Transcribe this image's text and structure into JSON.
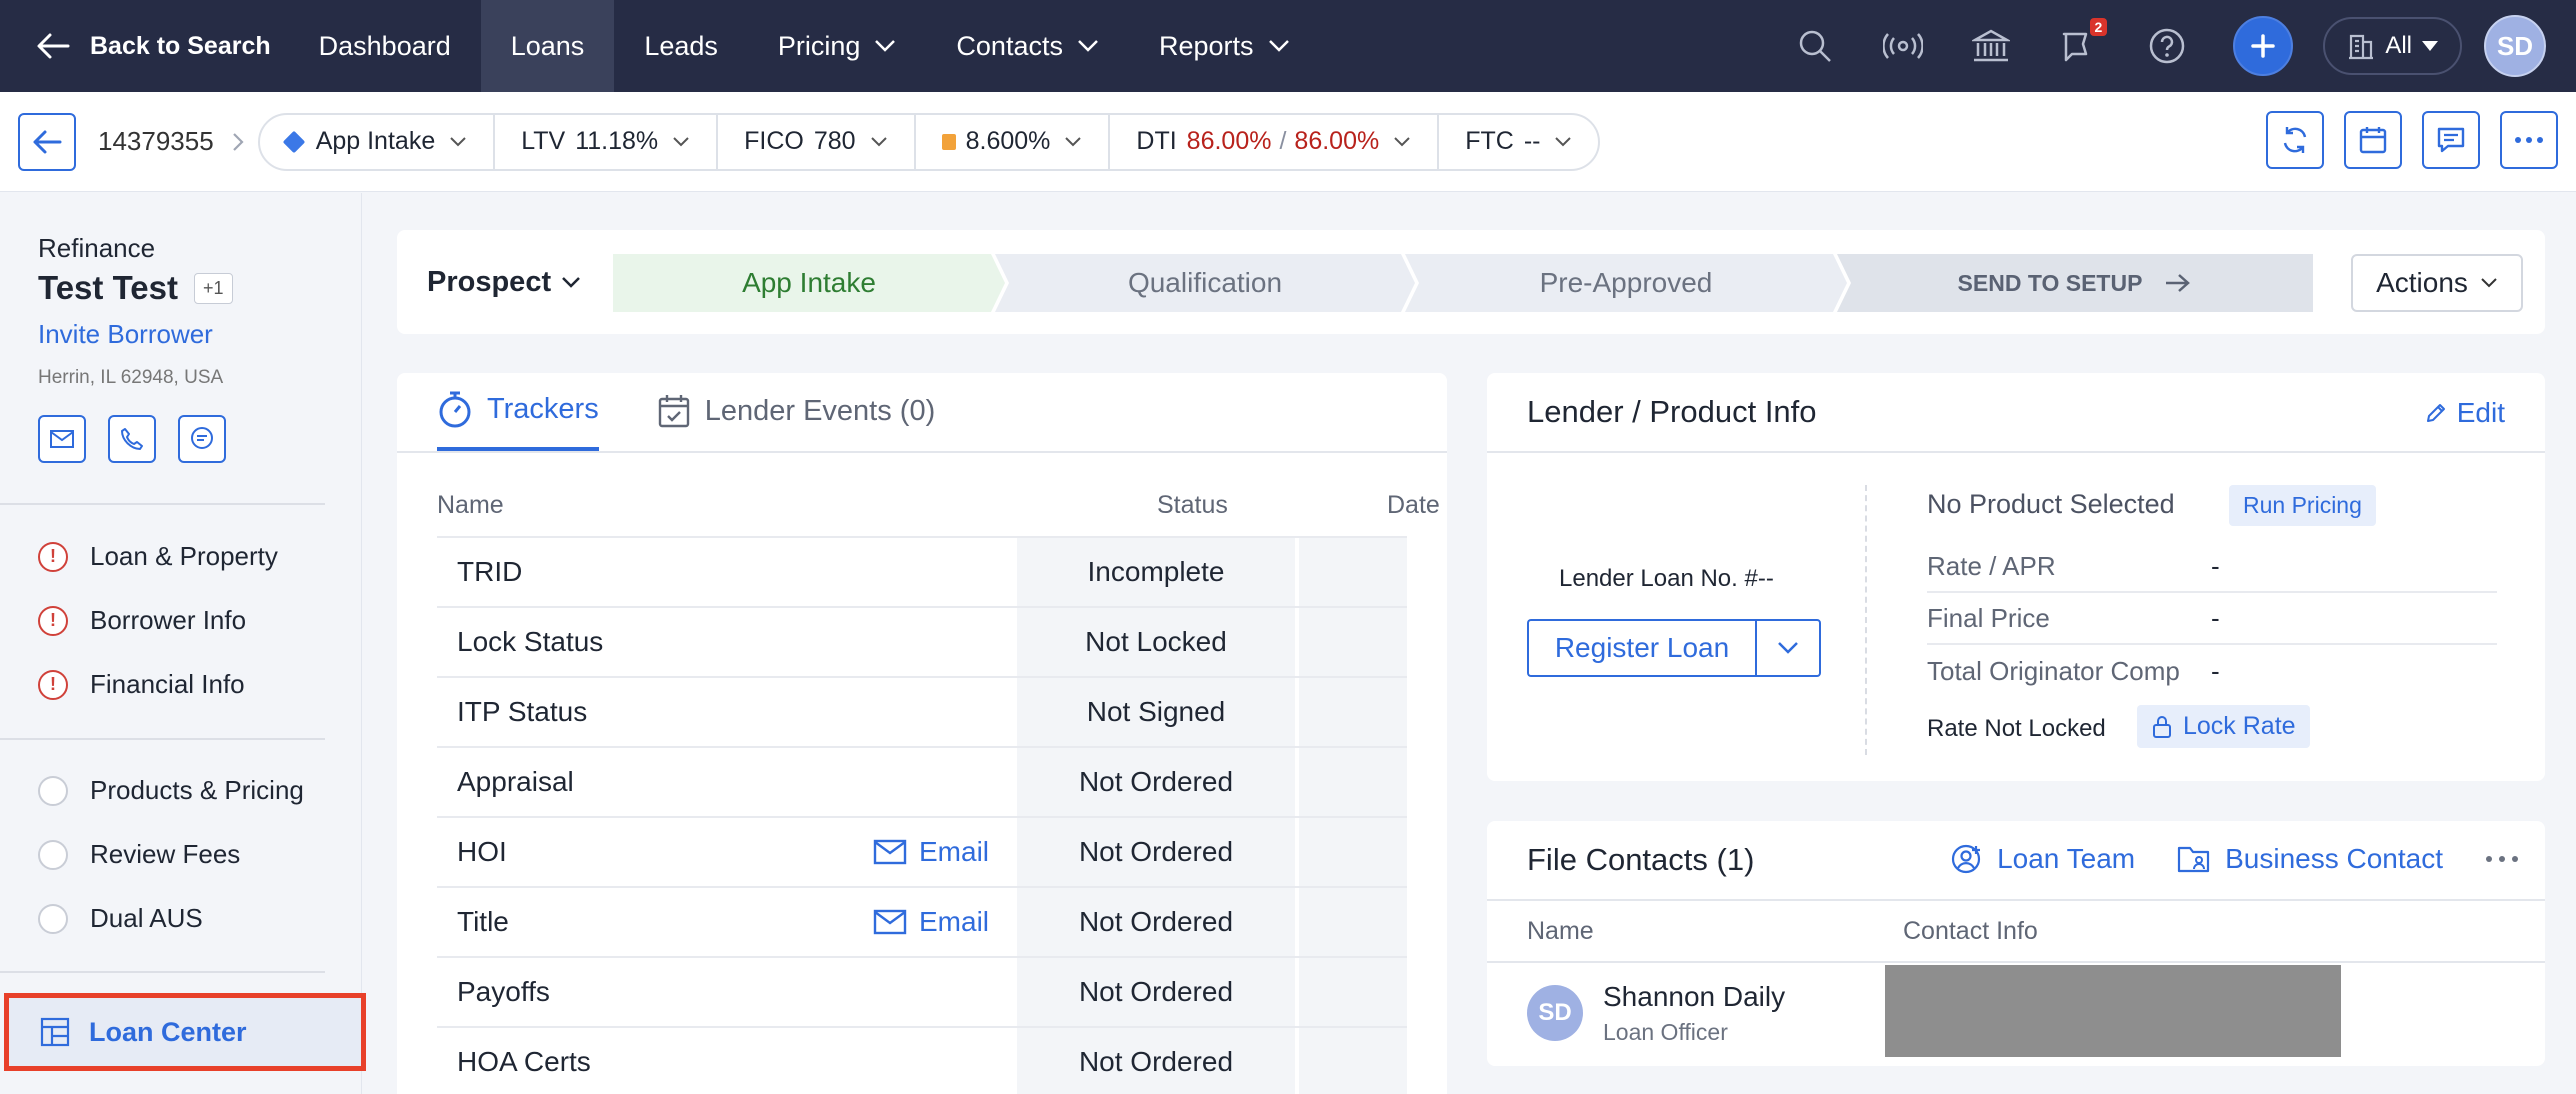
{
  "nav": {
    "back": "Back to Search",
    "items": [
      "Dashboard",
      "Loans",
      "Leads",
      "Pricing",
      "Contacts",
      "Reports"
    ],
    "notification_count": "2",
    "org_filter": "All",
    "user_initials": "SD"
  },
  "loanbar": {
    "loan_number": "14379355",
    "stage": "App Intake",
    "ltv_label": "LTV",
    "ltv_value": "11.18%",
    "fico_label": "FICO",
    "fico_value": "780",
    "rate_value": "8.600%",
    "dti_label": "DTI",
    "dti_front": "86.00%",
    "dti_sep": "/",
    "dti_back": "86.00%",
    "ftc_label": "FTC",
    "ftc_value": "--"
  },
  "borrower": {
    "loan_type": "Refinance",
    "name": "Test Test",
    "extra_count": "+1",
    "invite": "Invite Borrower",
    "address": "Herrin, IL 62948, USA"
  },
  "sidebar": {
    "warn_items": [
      "Loan & Property",
      "Borrower Info",
      "Financial Info"
    ],
    "todo_items": [
      "Products & Pricing",
      "Review Fees",
      "Dual AUS"
    ],
    "active_item": "Loan Center"
  },
  "stagebar": {
    "status": "Prospect",
    "stages": [
      "App Intake",
      "Qualification",
      "Pre-Approved"
    ],
    "send": "SEND TO SETUP",
    "actions": "Actions"
  },
  "trackers": {
    "tab_trackers": "Trackers",
    "tab_events": "Lender Events (0)",
    "headers": {
      "name": "Name",
      "status": "Status",
      "date": "Date"
    },
    "email_label": "Email",
    "rows": [
      {
        "name": "TRID",
        "status": "Incomplete",
        "email": false
      },
      {
        "name": "Lock Status",
        "status": "Not Locked",
        "email": false
      },
      {
        "name": "ITP Status",
        "status": "Not Signed",
        "email": false
      },
      {
        "name": "Appraisal",
        "status": "Not Ordered",
        "email": false
      },
      {
        "name": "HOI",
        "status": "Not Ordered",
        "email": true
      },
      {
        "name": "Title",
        "status": "Not Ordered",
        "email": true
      },
      {
        "name": "Payoffs",
        "status": "Not Ordered",
        "email": false
      },
      {
        "name": "HOA Certs",
        "status": "Not Ordered",
        "email": false
      }
    ]
  },
  "lender": {
    "title": "Lender / Product Info",
    "edit": "Edit",
    "loan_no": "Lender Loan No. #--",
    "register": "Register Loan",
    "no_product": "No Product Selected",
    "run_pricing": "Run Pricing",
    "fields": [
      {
        "label": "Rate / APR",
        "value": "-"
      },
      {
        "label": "Final Price",
        "value": "-"
      },
      {
        "label": "Total Originator Comp",
        "value": "-"
      }
    ],
    "rate_status": "Rate Not Locked",
    "lock_rate": "Lock Rate"
  },
  "contacts": {
    "title": "File Contacts (1)",
    "loan_team": "Loan Team",
    "business_contact": "Business Contact",
    "col_name": "Name",
    "col_info": "Contact Info",
    "person": {
      "initials": "SD",
      "name": "Shannon Daily",
      "role": "Loan Officer"
    }
  }
}
